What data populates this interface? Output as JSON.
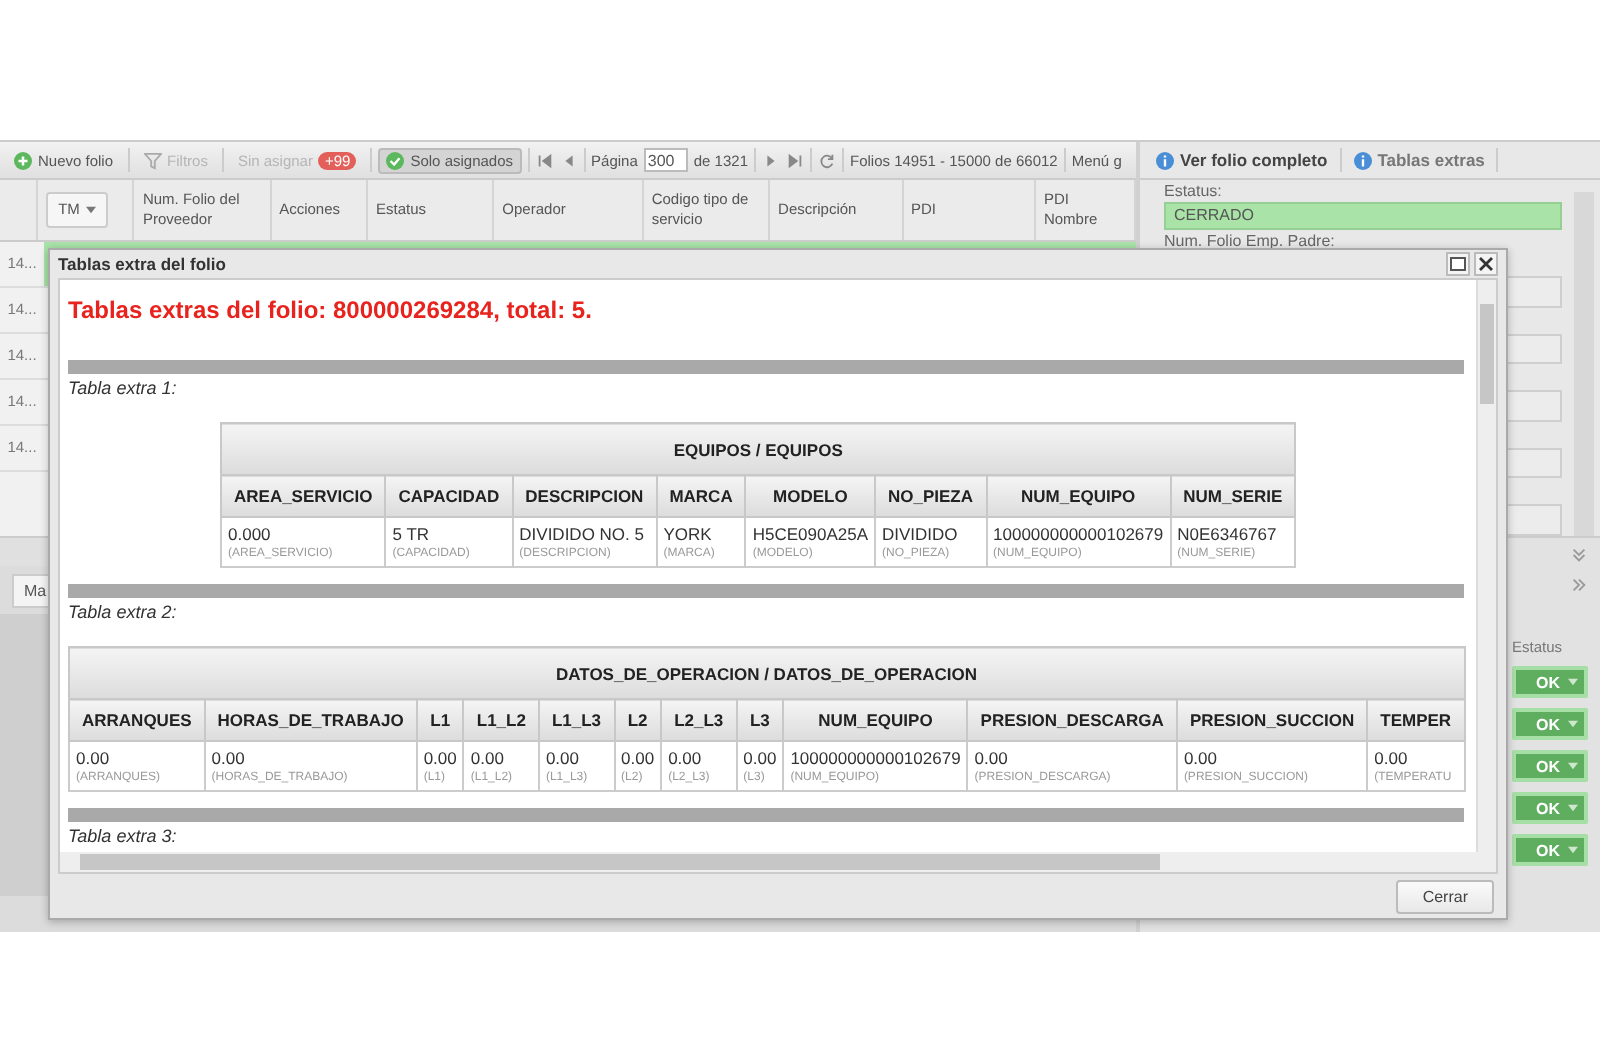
{
  "toolbar": {
    "buttons": [
      {
        "label": "Nuevo folio",
        "kind": "add",
        "disabled": false,
        "selected": false
      },
      {
        "label": "Filtros",
        "kind": "filter",
        "disabled": true,
        "selected": false
      },
      {
        "label": "Sin asignar",
        "kind": "badge",
        "badge": "+99",
        "disabled": true,
        "selected": false
      },
      {
        "label": "Solo asignados",
        "kind": "check",
        "disabled": false,
        "selected": true
      }
    ],
    "pager": {
      "page_label": "Página",
      "page": "300",
      "total": "de 1321"
    },
    "range": "Folios 14951 - 15000 de 66012",
    "menu": "Menú g"
  },
  "grid": {
    "columns": [
      {
        "label": "TM",
        "kind": "dropdown"
      },
      {
        "label": "Num. Folio del Proveedor",
        "kind": "text"
      },
      {
        "label": "Acciones",
        "kind": "text"
      },
      {
        "label": "Estatus",
        "kind": "text"
      },
      {
        "label": "Operador",
        "kind": "text"
      },
      {
        "label": "Codigo tipo de servicio",
        "kind": "text"
      },
      {
        "label": "Descripción",
        "kind": "text"
      },
      {
        "label": "PDI",
        "kind": "text"
      },
      {
        "label": "PDI Nombre",
        "kind": "text"
      }
    ],
    "rows": [
      {
        "number": "14...",
        "selected": true
      },
      {
        "number": "14...",
        "selected": false
      },
      {
        "number": "14...",
        "selected": false
      },
      {
        "number": "14...",
        "selected": false
      },
      {
        "number": "14...",
        "selected": false
      }
    ]
  },
  "side_panel": {
    "tabs": [
      {
        "label": "Ver folio completo",
        "selected": true
      },
      {
        "label": "Tablas extras",
        "selected": false
      }
    ],
    "fields": [
      {
        "label": "Estatus:",
        "value": "CERRADO"
      },
      {
        "label": "Num. Folio Emp. Padre:"
      }
    ]
  },
  "lower_panel": {
    "tab": "Ma",
    "status_header": "Estatus",
    "status_buttons": [
      "OK",
      "OK",
      "OK",
      "OK",
      "OK"
    ]
  },
  "dialog": {
    "title": "Tablas extra del folio",
    "heading": "Tablas extras del folio: 800000269284, total: 5.",
    "tables": [
      {
        "caption": "Tabla extra 1:",
        "title": "EQUIPOS / EQUIPOS",
        "columns": [
          "AREA_SERVICIO",
          "CAPACIDAD",
          "DESCRIPCION",
          "MARCA",
          "MODELO",
          "NO_PIEZA",
          "NUM_EQUIPO",
          "NUM_SERIE"
        ],
        "cells": [
          {
            "value": "0.000",
            "hint": "(AREA_SERVICIO)"
          },
          {
            "value": "5 TR",
            "hint": "(CAPACIDAD)"
          },
          {
            "value": "DIVIDIDO NO. 5",
            "hint": "(DESCRIPCION)"
          },
          {
            "value": "YORK",
            "hint": "(MARCA)"
          },
          {
            "value": "H5CE090A25A",
            "hint": "(MODELO)"
          },
          {
            "value": "DIVIDIDO",
            "hint": "(NO_PIEZA)"
          },
          {
            "value": "100000000000102679",
            "hint": "(NUM_EQUIPO)"
          },
          {
            "value": "N0E6346767",
            "hint": "(NUM_SERIE)"
          }
        ]
      },
      {
        "caption": "Tabla extra 2:",
        "title": "DATOS_DE_OPERACION / DATOS_DE_OPERACION",
        "columns": [
          "ARRANQUES",
          "HORAS_DE_TRABAJO",
          "L1",
          "L1_L2",
          "L1_L3",
          "L2",
          "L2_L3",
          "L3",
          "NUM_EQUIPO",
          "PRESION_DESCARGA",
          "PRESION_SUCCION",
          "TEMPER"
        ],
        "cells": [
          {
            "value": "0.00",
            "hint": "(ARRANQUES)"
          },
          {
            "value": "0.00",
            "hint": "(HORAS_DE_TRABAJO)"
          },
          {
            "value": "0.00",
            "hint": "(L1)"
          },
          {
            "value": "0.00",
            "hint": "(L1_L2)"
          },
          {
            "value": "0.00",
            "hint": "(L1_L3)"
          },
          {
            "value": "0.00",
            "hint": "(L2)"
          },
          {
            "value": "0.00",
            "hint": "(L2_L3)"
          },
          {
            "value": "0.00",
            "hint": "(L3)"
          },
          {
            "value": "100000000000102679",
            "hint": "(NUM_EQUIPO)"
          },
          {
            "value": "0.00",
            "hint": "(PRESION_DESCARGA)"
          },
          {
            "value": "0.00",
            "hint": "(PRESION_SUCCION)"
          },
          {
            "value": "0.00",
            "hint": "(TEMPERATU"
          }
        ]
      }
    ],
    "next_caption": "Tabla extra 3:",
    "close_button": "Cerrar"
  }
}
